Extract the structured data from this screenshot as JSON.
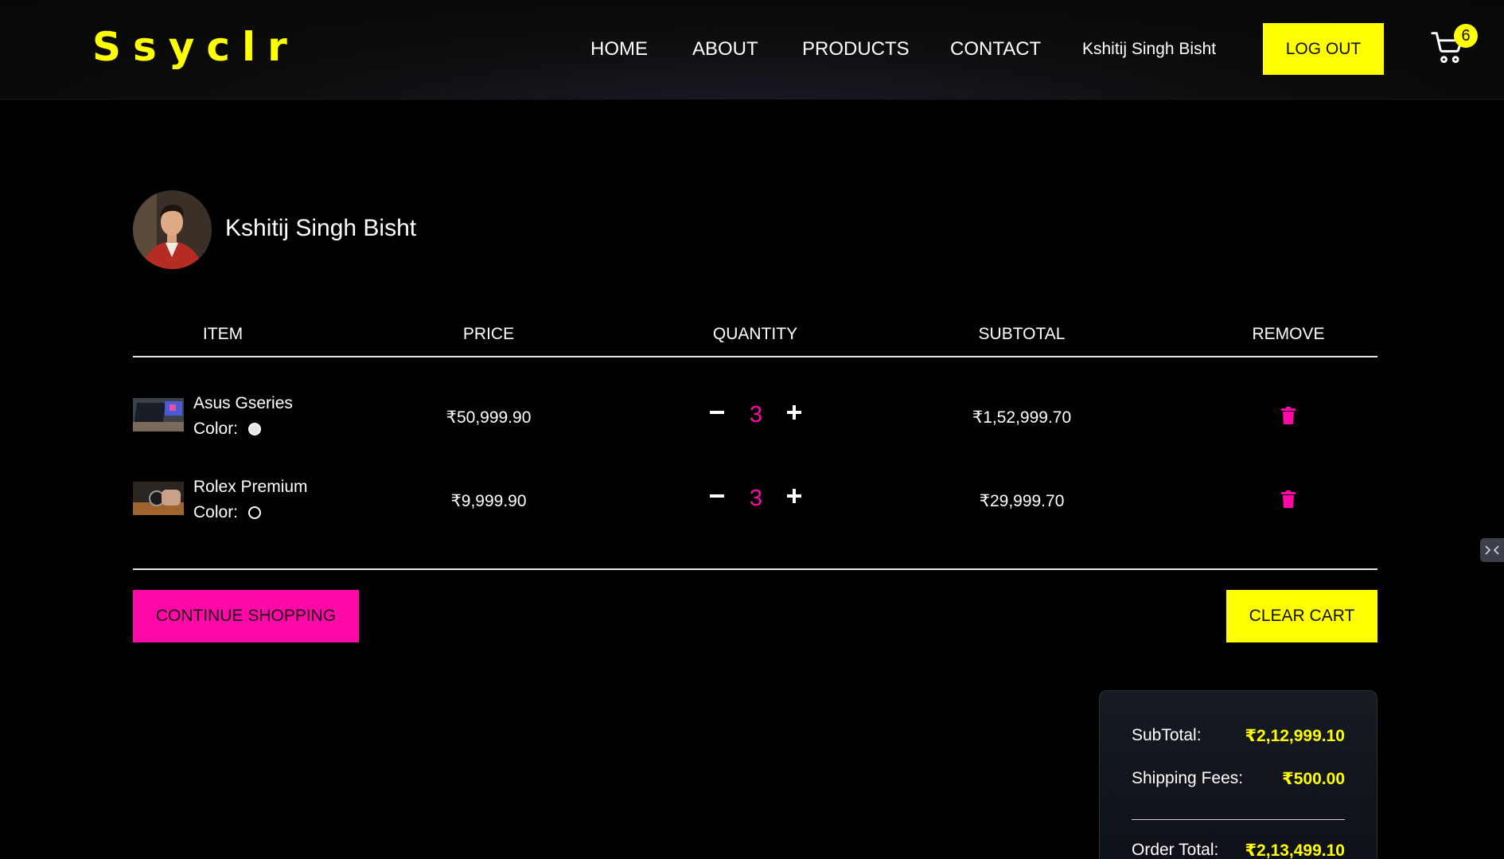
{
  "header": {
    "logo": "Ssyclr",
    "nav": [
      "HOME",
      "ABOUT",
      "PRODUCTS",
      "CONTACT"
    ],
    "user": "Kshitij Singh Bisht",
    "logout_label": "LOG OUT",
    "cart_count": "6"
  },
  "profile": {
    "name": "Kshitij Singh Bisht"
  },
  "table": {
    "headers": [
      "ITEM",
      "PRICE",
      "QUANTITY",
      "SUBTOTAL",
      "REMOVE"
    ],
    "color_label": "Color:",
    "rows": [
      {
        "name": "Asus Gseries",
        "color": "#e6e6e6",
        "price": "₹50,999.90",
        "qty": "3",
        "subtotal": "₹1,52,999.70"
      },
      {
        "name": "Rolex Premium",
        "color": "#000000",
        "price": "₹9,999.90",
        "qty": "3",
        "subtotal": "₹29,999.70"
      }
    ]
  },
  "actions": {
    "continue_label": "CONTINUE SHOPPING",
    "clear_label": "CLEAR CART"
  },
  "summary": {
    "subtotal_label": "SubTotal:",
    "subtotal_value": "₹2,12,999.10",
    "shipping_label": "Shipping Fees:",
    "shipping_value": "₹500.00",
    "total_label": "Order Total:",
    "total_value": "₹2,13,499.10"
  },
  "colors": {
    "accent_yellow": "#ffff00",
    "accent_pink": "#ff0aa8",
    "background": "#000000"
  }
}
